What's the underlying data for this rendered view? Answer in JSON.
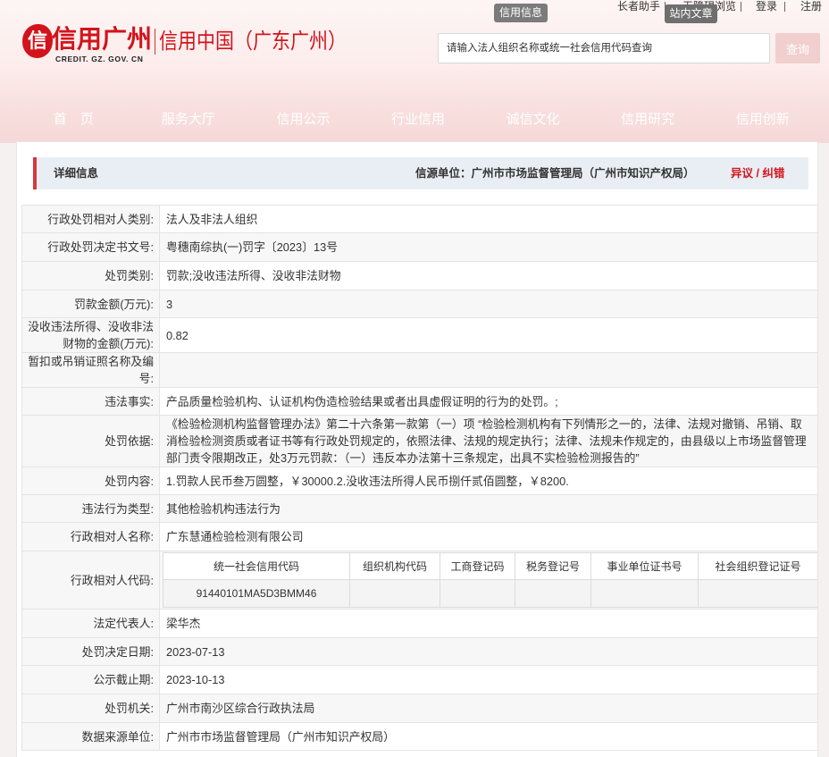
{
  "header": {
    "logo_seal": "信",
    "logo_text": "信用广州",
    "logo_sub": "CREDIT. GZ. GOV. CN",
    "site_title": "信用中国（广东广州）",
    "top_links": [
      "长者助手",
      "无障碍浏览",
      "登录",
      "注册"
    ],
    "tabs": [
      "信用信息",
      "站内文章"
    ],
    "search_placeholder": "请输入法人组织名称或统一社会信用代码查询",
    "search_button": "查询"
  },
  "nav": [
    "首　页",
    "服务大厅",
    "信用公示",
    "行业信用",
    "诚信文化",
    "信用研究",
    "信用创新"
  ],
  "detail": {
    "title": "详细信息",
    "source": "信源单位：广州市市场监督管理局（广州市知识产权局）",
    "objection": "异议 / 纠错"
  },
  "rows": [
    {
      "label": "行政处罚相对人类别:",
      "value": "法人及非法人组织"
    },
    {
      "label": "行政处罚决定书文号:",
      "value": "粤穗南综执(一)罚字〔2023〕13号"
    },
    {
      "label": "处罚类别:",
      "value": "罚款;没收违法所得、没收非法财物"
    },
    {
      "label": "罚款金额(万元):",
      "value": "3"
    },
    {
      "label": "没收违法所得、没收非法财物的金额(万元):",
      "value": "0.82"
    },
    {
      "label": "暂扣或吊销证照名称及编号:",
      "value": ""
    },
    {
      "label": "违法事实:",
      "value": "产品质量检验机构、认证机构伪造检验结果或者出具虚假证明的行为的处罚。;"
    },
    {
      "label": "处罚依据:",
      "value": "《检验检测机构监督管理办法》第二十六条第一款第（一）项 “检验检测机构有下列情形之一的，法律、法规对撤销、吊销、取消检验检测资质或者证书等有行政处罚规定的，依照法律、法规的规定执行；法律、法规未作规定的，由县级以上市场监督管理部门责令限期改正，处3万元罚款：（一）违反本办法第十三条规定，出具不实检验检测报告的”"
    },
    {
      "label": "处罚内容:",
      "value": "1.罚款人民币叁万圆整，￥30000.2.没收违法所得人民币捌仟贰佰圆整，￥8200."
    },
    {
      "label": "违法行为类型:",
      "value": "其他检验机构违法行为"
    },
    {
      "label": "行政相对人名称:",
      "value": "广东慧通检验检测有限公司"
    },
    {
      "label": "行政相对人代码:",
      "code_table": {
        "headers": [
          "统一社会信用代码",
          "组织机构代码",
          "工商登记码",
          "税务登记号",
          "事业单位证书号",
          "社会组织登记证号"
        ],
        "values": [
          "91440101MA5D3BMM46",
          "",
          "",
          "",
          "",
          ""
        ]
      }
    },
    {
      "label": "法定代表人:",
      "value": "梁华杰"
    },
    {
      "label": "处罚决定日期:",
      "value": "2023-07-13"
    },
    {
      "label": "公示截止期:",
      "value": "2023-10-13"
    },
    {
      "label": "处罚机关:",
      "value": "广州市南沙区综合行政执法局"
    },
    {
      "label": "数据来源单位:",
      "value": "广州市市场监督管理局（广州市知识产权局）"
    }
  ],
  "colors": {
    "brand_red": "#d3131b",
    "header_bar": "#e9eef4",
    "accent_border": "#d9363e"
  }
}
